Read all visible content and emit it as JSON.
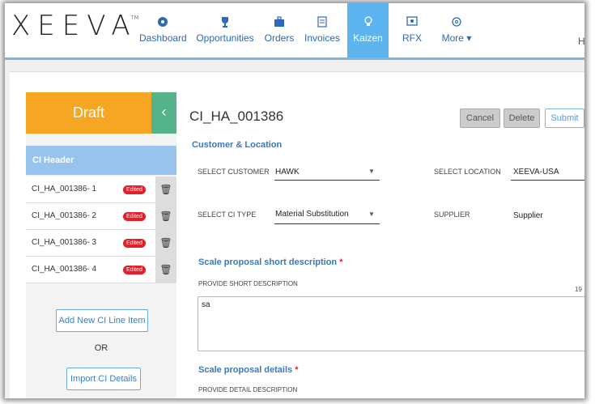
{
  "brand": {
    "logo_text": "XEEVA",
    "tm": "TM"
  },
  "nav": {
    "items": [
      {
        "label": "Dashboard",
        "icon": "dashboard-icon"
      },
      {
        "label": "Opportunities",
        "icon": "trophy-icon"
      },
      {
        "label": "Orders",
        "icon": "briefcase-icon"
      },
      {
        "label": "Invoices",
        "icon": "document-icon"
      },
      {
        "label": "Kaizen",
        "icon": "lightbulb-icon"
      },
      {
        "label": "RFX",
        "icon": "rfx-icon"
      },
      {
        "label": "More ▾",
        "icon": "gear-icon"
      }
    ],
    "cut_text": "H"
  },
  "left": {
    "status": "Draft",
    "collapse_glyph": "‹",
    "ci_header": "CI Header",
    "lines": [
      {
        "name": "CI_HA_001386- 1",
        "badge": "Edited"
      },
      {
        "name": "CI_HA_001386- 2",
        "badge": "Edited"
      },
      {
        "name": "CI_HA_001386- 3",
        "badge": "Edited"
      },
      {
        "name": "CI_HA_001386- 4",
        "badge": "Edited"
      }
    ],
    "add_button": "Add New CI Line Item",
    "or": "OR",
    "import_button": "Import CI Details"
  },
  "right": {
    "title": "CI_HA_001386",
    "cancel": "Cancel",
    "delete": "Delete",
    "submit": "Submit",
    "section_customer": "Customer & Location",
    "select_customer_label": "SELECT CUSTOMER",
    "select_customer_value": "HAWK",
    "select_location_label": "SELECT LOCATION",
    "select_location_value": "XEEVA-USA",
    "select_ci_type_label": "SELECT CI TYPE",
    "select_ci_type_value": "Material Substitution",
    "supplier_label": "SUPPLIER",
    "supplier_value": "Supplier",
    "short_desc_heading": "Scale proposal short description",
    "short_desc_sublabel": "PROVIDE SHORT DESCRIPTION",
    "short_desc_count": "19",
    "short_desc_value": "sa",
    "details_heading": "Scale proposal details",
    "details_sublabel": "PROVIDE DETAIL DESCRIPTION",
    "required_mark": "*"
  }
}
